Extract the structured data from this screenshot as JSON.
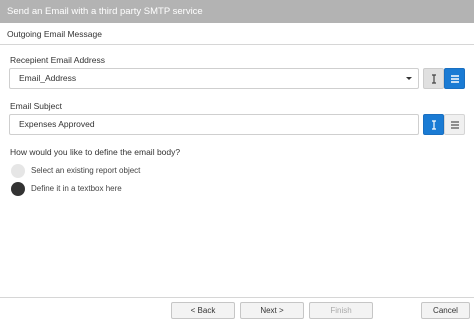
{
  "window": {
    "title": "Send an Email with a third party SMTP service"
  },
  "section": {
    "title": "Outgoing Email Message"
  },
  "recipient": {
    "label": "Recepient Email Address",
    "value": "Email_Address"
  },
  "subject": {
    "label": "Email Subject",
    "value": "Expenses Approved"
  },
  "body": {
    "question": "How would you like to define the email body?",
    "options": [
      {
        "label": "Select an existing report object",
        "selected": false
      },
      {
        "label": "Define it in a textbox here",
        "selected": true
      }
    ]
  },
  "footer": {
    "back": "< Back",
    "next": "Next >",
    "finish": "Finish",
    "cancel": "Cancel"
  },
  "colors": {
    "accent": "#1a7bd4",
    "titlebar": "#b3b3b3"
  },
  "icons": {
    "text_mode": "text-cursor-icon",
    "list_mode": "list-icon"
  }
}
